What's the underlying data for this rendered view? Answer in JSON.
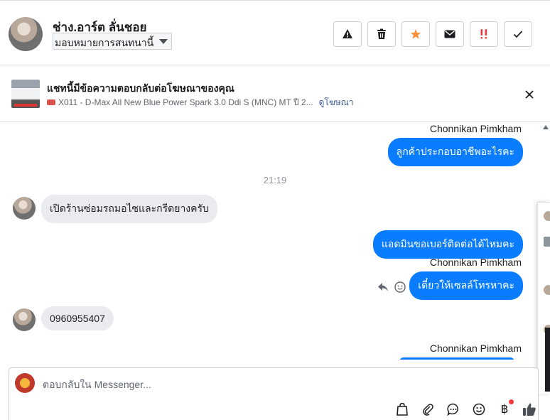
{
  "header": {
    "contact_name": "ช่าง.อาร์ต ลั่นชอย",
    "assign_label": "มอบหมายการสนทนานี้",
    "toolbar": [
      {
        "name": "report-spam-icon",
        "label": "spam"
      },
      {
        "name": "delete-icon",
        "label": "delete"
      },
      {
        "name": "star-icon",
        "label": "star",
        "color": "#f7923b"
      },
      {
        "name": "mark-unread-icon",
        "label": "unread"
      },
      {
        "name": "follow-up-icon",
        "label": "follow-up",
        "color": "#fa383e"
      },
      {
        "name": "done-check-icon",
        "label": "done"
      }
    ]
  },
  "ad_banner": {
    "title": "แชทนี้มีข้อความตอบกลับต่อโฆษณาของคุณ",
    "ad_text": "X011 - D-Max All New Blue Power Spark 3.0 Ddi S (MNC) MT ปี 2...",
    "view_ad_link": "ดูโฆษณา"
  },
  "messages": [
    {
      "type": "sender",
      "text": "Chonnikan Pimkham"
    },
    {
      "type": "out",
      "text": "ลูกค้าประกอบอาชีพอะไรคะ"
    },
    {
      "type": "time",
      "text": "21:19"
    },
    {
      "type": "in",
      "text": "เปิดร้านซ่อมรถมอไซและกรีดยางครับ"
    },
    {
      "type": "out",
      "text": "แอดมินขอเบอร์ติดต่อได้ไหมคะ"
    },
    {
      "type": "sender",
      "text": "Chonnikan Pimkham"
    },
    {
      "type": "out",
      "text": "เดี๋ยวให้เซลล์โทรหาคะ"
    },
    {
      "type": "in",
      "text": "0960955407"
    },
    {
      "type": "sender",
      "text": "Chonnikan Pimkham"
    }
  ],
  "composer": {
    "placeholder": "ตอบกลับใน Messenger...",
    "icons": [
      "shopping-bag-icon",
      "attachment-icon",
      "chat-bubble-icon",
      "emoji-icon",
      "baht-payment-icon",
      "thumbs-up-icon"
    ],
    "baht_symbol": "฿"
  },
  "colors": {
    "accent": "#0a7cff",
    "incoming_bubble": "#e9ebee",
    "link": "#385898"
  }
}
